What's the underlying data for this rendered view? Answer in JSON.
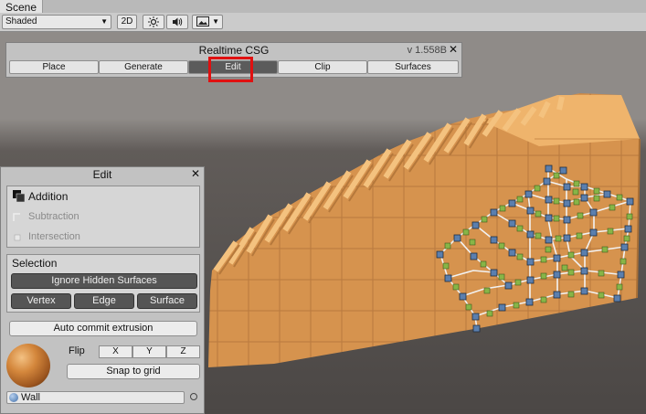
{
  "window": {
    "tab": "Scene"
  },
  "toolbar": {
    "shading_mode": "Shaded",
    "mode_2d": "2D",
    "icons": [
      "sun-icon",
      "speaker-icon",
      "image-icon"
    ]
  },
  "csg_panel": {
    "title": "Realtime CSG",
    "version": "v 1.558B",
    "modes": [
      {
        "label": "Place",
        "active": false
      },
      {
        "label": "Generate",
        "active": false
      },
      {
        "label": "Edit",
        "active": true
      },
      {
        "label": "Clip",
        "active": false
      },
      {
        "label": "Surfaces",
        "active": false
      }
    ]
  },
  "edit_panel": {
    "title": "Edit",
    "operations": [
      {
        "label": "Addition",
        "enabled": true
      },
      {
        "label": "Subtraction",
        "enabled": false
      },
      {
        "label": "Intersection",
        "enabled": false
      }
    ],
    "selection": {
      "label": "Selection",
      "ignore_hidden": "Ignore Hidden Surfaces",
      "modes": [
        "Vertex",
        "Edge",
        "Surface"
      ]
    },
    "auto_commit": "Auto commit extrusion",
    "flip": {
      "label": "Flip",
      "axes": [
        "X",
        "Y",
        "Z"
      ]
    },
    "snap": "Snap to grid",
    "material": "Wall"
  },
  "colors": {
    "active_button": "#5b5b5b",
    "highlight": "#e01010",
    "brush": "#e9a25a",
    "handle_vertex": "#5b7fae",
    "handle_edge": "#88b547"
  }
}
